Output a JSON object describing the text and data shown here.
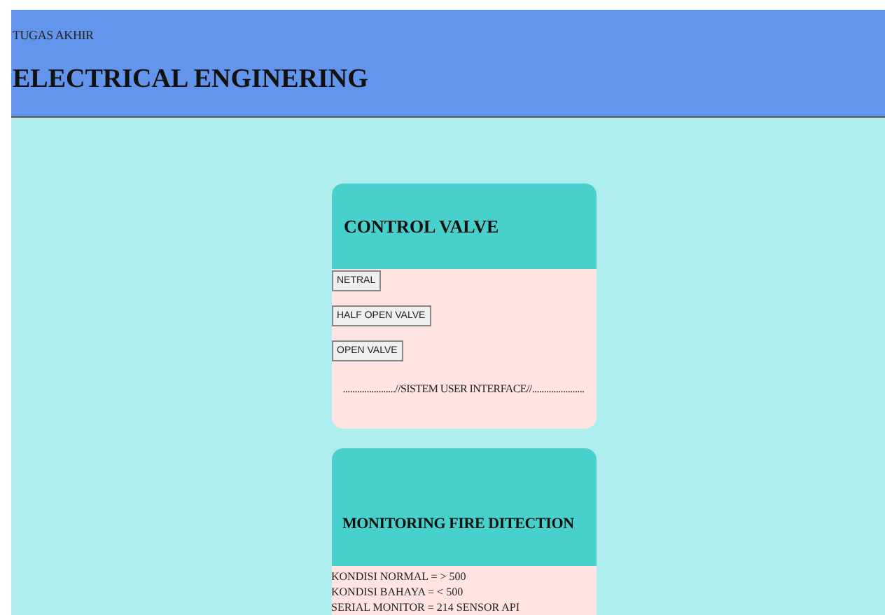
{
  "header": {
    "subtitle": "TUGAS AKHIR",
    "title": "ELECTRICAL ENGINERING"
  },
  "control_card": {
    "title": "CONTROL VALVE",
    "buttons": [
      "NETRAL",
      "HALF OPEN VALVE",
      "OPEN VALVE"
    ],
    "footer": "......................//SISTEM USER INTERFACE//......................"
  },
  "monitoring_card": {
    "title": "MONITORING FIRE DITECTION",
    "lines": [
      "KONDISI NORMAL = > 500",
      "KONDISI BAHAYA = < 500",
      "SERIAL MONITOR = 214 SENSOR API"
    ]
  }
}
